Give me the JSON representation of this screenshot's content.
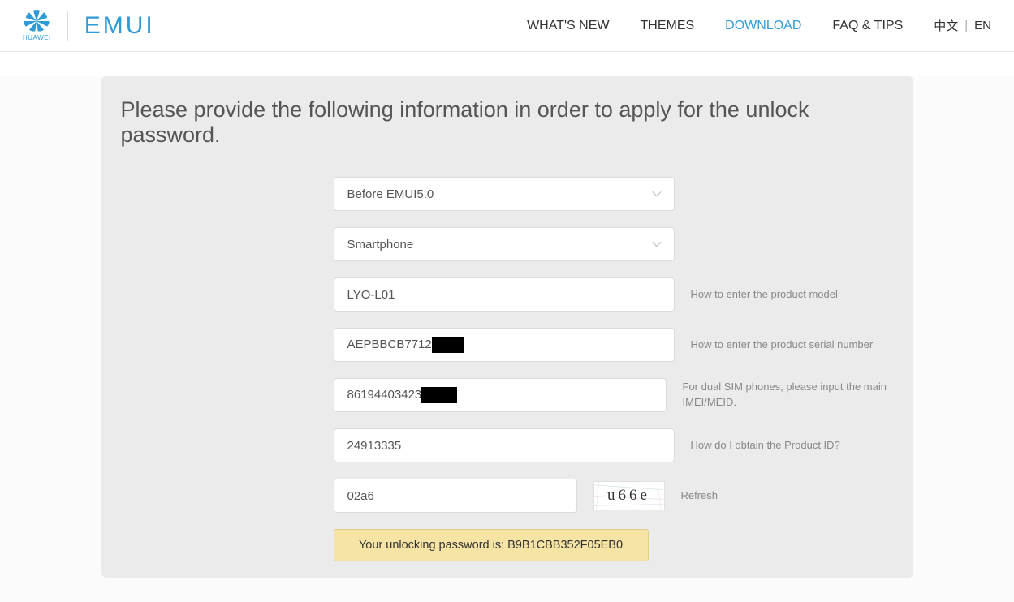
{
  "header": {
    "brand_huawei": "HUAWEI",
    "brand_emui": "EMUI",
    "nav": {
      "whats_new": "WHAT'S NEW",
      "themes": "THEMES",
      "download": "DOWNLOAD",
      "faq_tips": "FAQ & TIPS"
    },
    "lang": {
      "zh": "中文",
      "sep": "|",
      "en": "EN"
    }
  },
  "page": {
    "title": "Please provide the following information in order to apply for the unlock password."
  },
  "form": {
    "emui_version": "Before EMUI5.0",
    "device_type": "Smartphone",
    "model": "LYO-L01",
    "model_hint": "How to enter the product model",
    "serial_prefix": "AEPBBCB7712",
    "serial_hint": "How to enter the product serial number",
    "imei_prefix": "86194403423",
    "imei_hint": "For dual SIM phones, please input the main IMEI/MEID.",
    "product_id": "24913335",
    "product_id_hint": "How do I obtain the Product ID?",
    "captcha_input": "02a6",
    "captcha_text": "u66e",
    "refresh_label": "Refresh"
  },
  "result": {
    "message": "Your unlocking password is: B9B1CBB352F05EB0"
  }
}
